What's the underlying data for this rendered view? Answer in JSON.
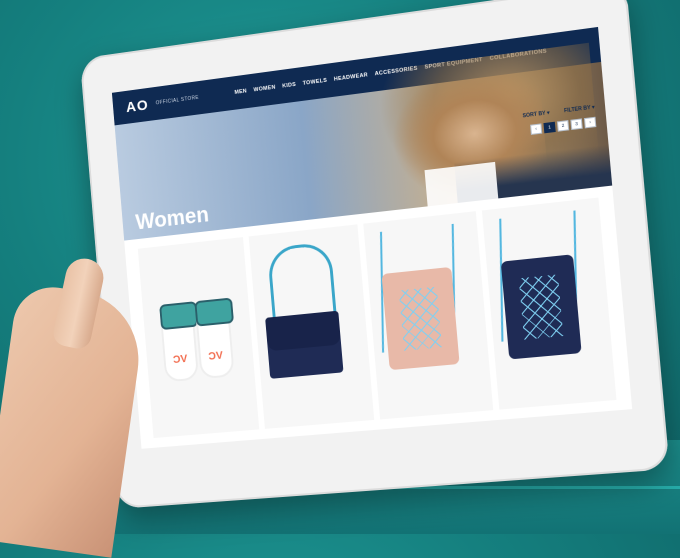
{
  "nav": {
    "logo": "AO",
    "store": "OFFICIAL STORE",
    "items": [
      "MEN",
      "WOMEN",
      "KIDS",
      "TOWELS",
      "HEADWEAR",
      "ACCESSORIES",
      "SPORT EQUIPMENT",
      "COLLABORATIONS"
    ]
  },
  "hero": {
    "title": "Women"
  },
  "controls": {
    "sort_by": "SORT BY ▾",
    "filter_by": "FILTER BY ▾"
  },
  "pager": [
    "‹",
    "1",
    "2",
    "3",
    "›"
  ],
  "colors": {
    "nav": "#0f2a52",
    "background": "#15807f",
    "accent": "#2bb9b5"
  },
  "products": [
    {
      "name": "slides"
    },
    {
      "name": "shoulder-bag"
    },
    {
      "name": "pink-drawstring-backpack"
    },
    {
      "name": "navy-drawstring-backpack"
    }
  ]
}
